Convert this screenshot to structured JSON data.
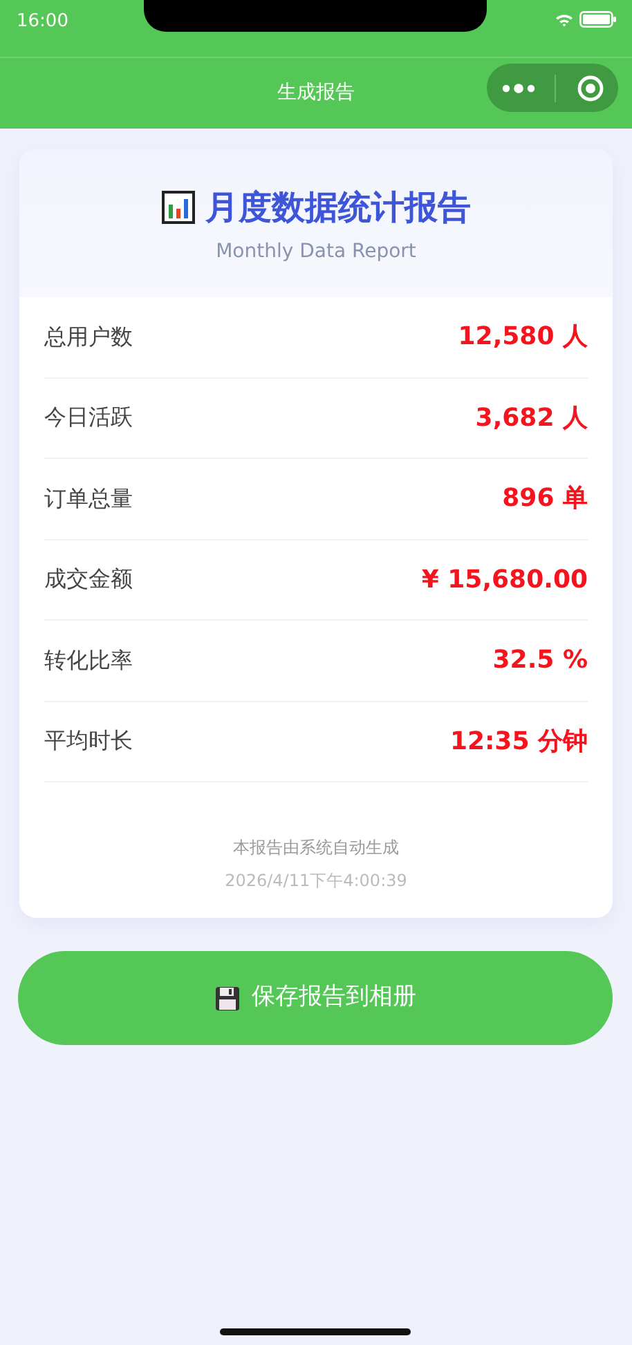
{
  "status_bar": {
    "time": "16:00"
  },
  "nav_bar": {
    "title": "生成报告"
  },
  "report": {
    "title": "月度数据统计报告",
    "subtitle": "Monthly Data Report",
    "rows": [
      {
        "label": "总用户数",
        "value": "12,580 人"
      },
      {
        "label": "今日活跃",
        "value": "3,682 人"
      },
      {
        "label": "订单总量",
        "value": "896 单"
      },
      {
        "label": "成交金额",
        "value": "¥ 15,680.00"
      },
      {
        "label": "转化比率",
        "value": "32.5 %"
      },
      {
        "label": "平均时长",
        "value": "12:35 分钟"
      }
    ],
    "footer_note": "本报告由系统自动生成",
    "timestamp": "2026/4/11下午4:00:39"
  },
  "save_button": {
    "label": "保存报告到相册"
  }
}
